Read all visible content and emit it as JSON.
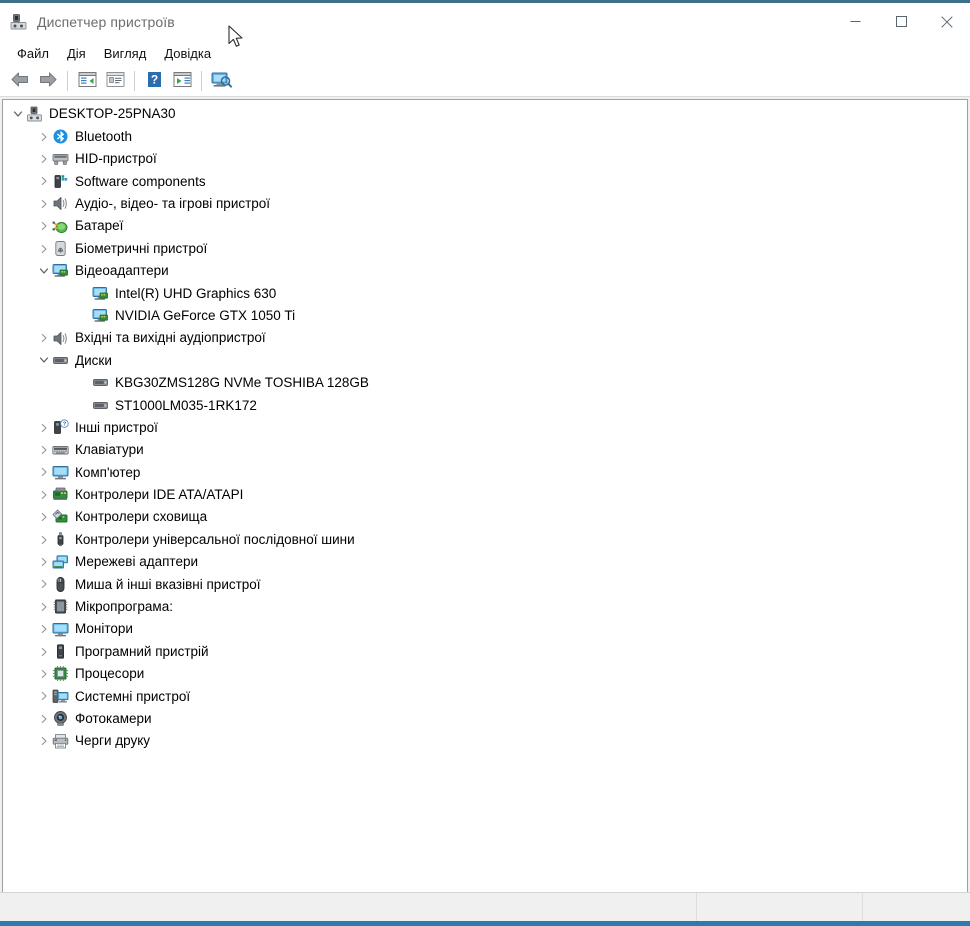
{
  "window": {
    "title": "Диспетчер пристроїв",
    "app_icon": "device-manager-icon",
    "accent_color": "#2b7cad",
    "controls": {
      "minimize": "—",
      "maximize": "□",
      "close": "✕"
    }
  },
  "menubar": {
    "items": [
      {
        "label": "Файл",
        "name": "menu-file"
      },
      {
        "label": "Дія",
        "name": "menu-action"
      },
      {
        "label": "Вигляд",
        "name": "menu-view"
      },
      {
        "label": "Довідка",
        "name": "menu-help"
      }
    ]
  },
  "toolbar": {
    "buttons": [
      {
        "icon": "back-arrow-icon",
        "name": "toolbar-back"
      },
      {
        "icon": "forward-arrow-icon",
        "name": "toolbar-forward"
      },
      {
        "icon": "show-hide-console-tree-icon",
        "name": "toolbar-console-tree"
      },
      {
        "icon": "properties-icon",
        "name": "toolbar-properties"
      },
      {
        "icon": "help-icon",
        "name": "toolbar-help"
      },
      {
        "icon": "update-driver-icon",
        "name": "toolbar-update-driver"
      },
      {
        "icon": "scan-hardware-changes-icon",
        "name": "toolbar-scan-hardware"
      }
    ]
  },
  "tree": {
    "nodes": [
      {
        "label": "DESKTOP-25PNA30",
        "level": 0,
        "state": "expanded",
        "icon": "computer-root-icon"
      },
      {
        "label": "Bluetooth",
        "level": 1,
        "state": "collapsed",
        "icon": "bluetooth-icon"
      },
      {
        "label": "HID-пристрої",
        "level": 1,
        "state": "collapsed",
        "icon": "hid-device-icon"
      },
      {
        "label": "Software components",
        "level": 1,
        "state": "collapsed",
        "icon": "software-component-icon"
      },
      {
        "label": "Аудіо-, відео- та ігрові пристрої",
        "level": 1,
        "state": "collapsed",
        "icon": "speaker-icon"
      },
      {
        "label": "Батареї",
        "level": 1,
        "state": "collapsed",
        "icon": "battery-icon"
      },
      {
        "label": "Біометричні пристрої",
        "level": 1,
        "state": "collapsed",
        "icon": "fingerprint-icon"
      },
      {
        "label": "Відеоадаптери",
        "level": 1,
        "state": "expanded",
        "icon": "display-adapter-icon"
      },
      {
        "label": "Intel(R) UHD Graphics 630",
        "level": 2,
        "state": "leaf",
        "icon": "display-adapter-icon"
      },
      {
        "label": "NVIDIA GeForce GTX 1050 Ti",
        "level": 2,
        "state": "leaf",
        "icon": "display-adapter-icon"
      },
      {
        "label": "Вхідні та вихідні аудіопристрої",
        "level": 1,
        "state": "collapsed",
        "icon": "speaker-icon"
      },
      {
        "label": "Диски",
        "level": 1,
        "state": "expanded",
        "icon": "disk-drive-icon"
      },
      {
        "label": "KBG30ZMS128G NVMe TOSHIBA 128GB",
        "level": 2,
        "state": "leaf",
        "icon": "disk-drive-icon"
      },
      {
        "label": "ST1000LM035-1RK172",
        "level": 2,
        "state": "leaf",
        "icon": "disk-drive-icon"
      },
      {
        "label": "Інші пристрої",
        "level": 1,
        "state": "collapsed",
        "icon": "unknown-device-icon"
      },
      {
        "label": "Клавіатури",
        "level": 1,
        "state": "collapsed",
        "icon": "keyboard-icon"
      },
      {
        "label": "Комп'ютер",
        "level": 1,
        "state": "collapsed",
        "icon": "monitor-icon"
      },
      {
        "label": "Контролери IDE ATA/ATAPI",
        "level": 1,
        "state": "collapsed",
        "icon": "ide-controller-icon"
      },
      {
        "label": "Контролери сховища",
        "level": 1,
        "state": "collapsed",
        "icon": "storage-controller-icon"
      },
      {
        "label": "Контролери універсальної послідовної шини",
        "level": 1,
        "state": "collapsed",
        "icon": "usb-icon"
      },
      {
        "label": "Мережеві адаптери",
        "level": 1,
        "state": "collapsed",
        "icon": "network-adapter-icon"
      },
      {
        "label": "Миша й інші вказівні пристрої",
        "level": 1,
        "state": "collapsed",
        "icon": "mouse-icon"
      },
      {
        "label": "Мікропрограма:",
        "level": 1,
        "state": "collapsed",
        "icon": "firmware-icon"
      },
      {
        "label": "Монітори",
        "level": 1,
        "state": "collapsed",
        "icon": "monitor-icon"
      },
      {
        "label": "Програмний пристрій",
        "level": 1,
        "state": "collapsed",
        "icon": "software-device-icon"
      },
      {
        "label": "Процесори",
        "level": 1,
        "state": "collapsed",
        "icon": "processor-icon"
      },
      {
        "label": "Системні пристрої",
        "level": 1,
        "state": "collapsed",
        "icon": "system-device-icon"
      },
      {
        "label": "Фотокамери",
        "level": 1,
        "state": "collapsed",
        "icon": "camera-icon"
      },
      {
        "label": "Черги друку",
        "level": 1,
        "state": "collapsed",
        "icon": "printer-icon"
      }
    ]
  },
  "statusbar": {
    "pane1": "",
    "pane2": "",
    "pane3": ""
  }
}
